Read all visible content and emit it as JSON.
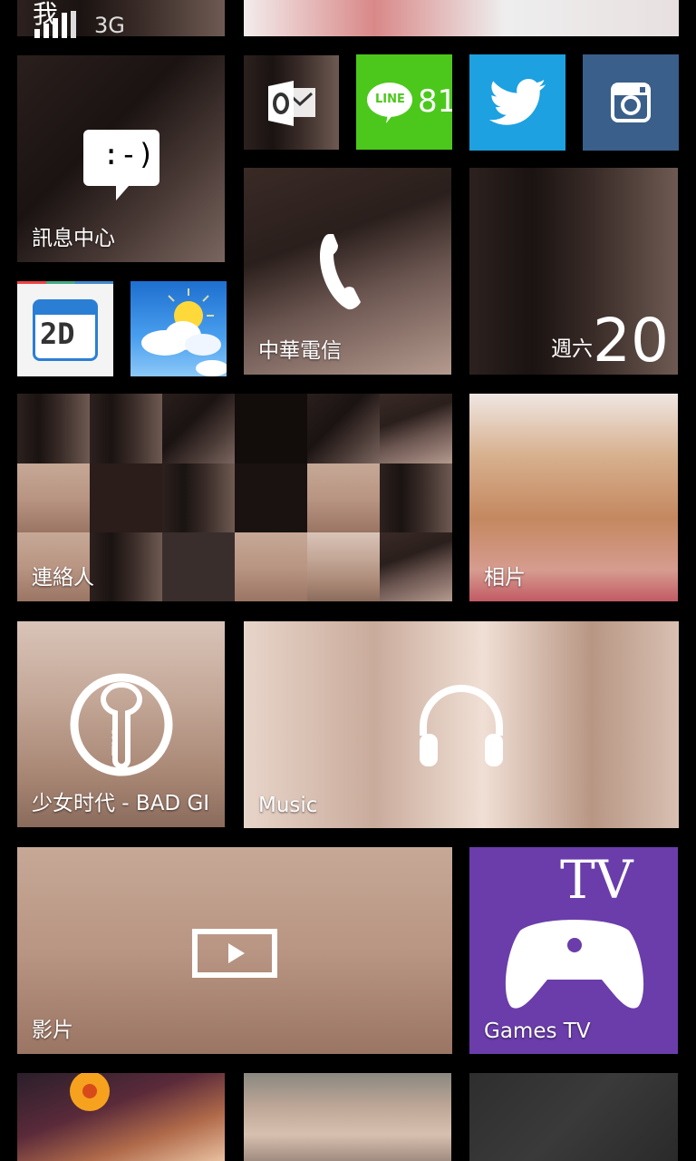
{
  "status_bar": {
    "signal_glyph": "我",
    "network": "3G"
  },
  "tiles": {
    "messaging": {
      "label": "訊息中心",
      "emoticon": ":-)"
    },
    "outlook": {
      "icon": "outlook-icon"
    },
    "line": {
      "brand": "LINE",
      "count": "81",
      "color": "#4cc81c"
    },
    "twitter": {
      "icon": "twitter-bird-icon",
      "color": "#1da1e0"
    },
    "instagram": {
      "icon": "instagram-icon",
      "color": "#3a5f8a"
    },
    "calendar_app": {
      "text": "2D"
    },
    "weather": {
      "icon": "weather-sun-cloud-icon"
    },
    "phone": {
      "label": "中華電信"
    },
    "calendar": {
      "day_label": "週六",
      "date": "20"
    },
    "contacts": {
      "label": "連絡人"
    },
    "photos": {
      "label": "相片"
    },
    "ttpod": {
      "label": "少女时代 - BAD GI",
      "brand": "TTPOD"
    },
    "music": {
      "label": "Music"
    },
    "video": {
      "label": "影片"
    },
    "games_tv": {
      "label": "Games TV",
      "brand_mark": "TV",
      "color": "#6a3daa"
    }
  }
}
